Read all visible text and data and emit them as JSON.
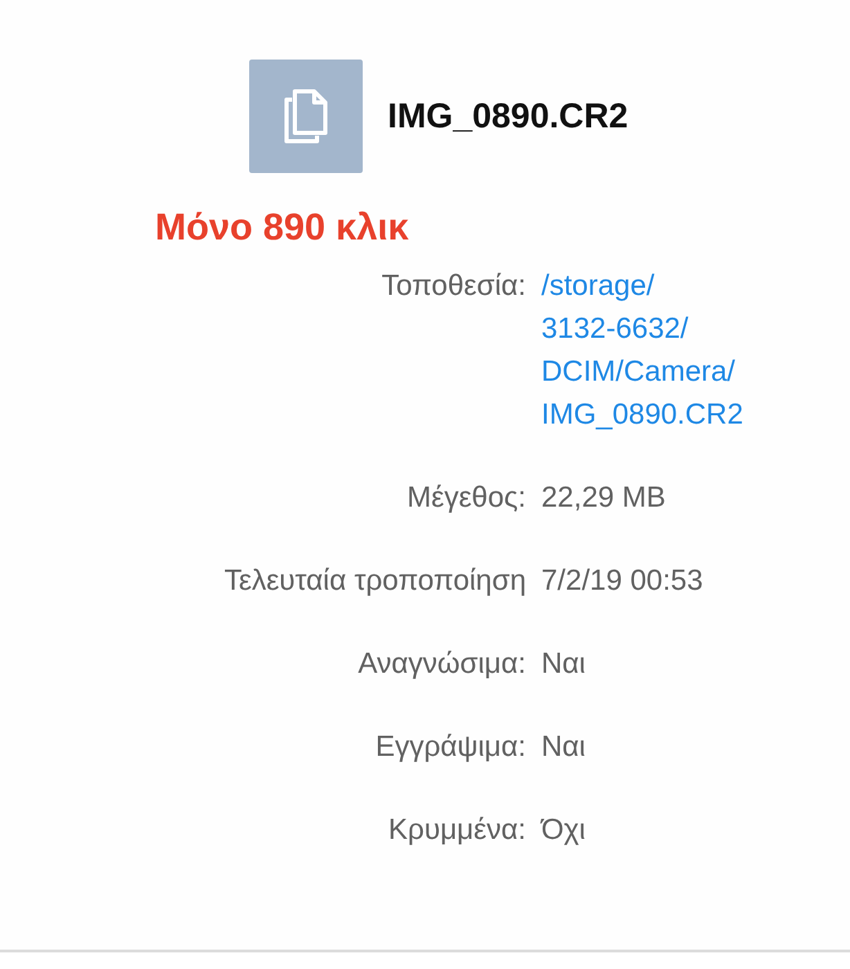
{
  "file": {
    "name": "IMG_0890.CR2"
  },
  "annotation": "Μόνο 890 κλικ",
  "properties": [
    {
      "label": "Τοποθεσία:",
      "kind": "link",
      "value_lines": [
        "/storage/",
        "3132-6632/",
        "DCIM/Camera/",
        "IMG_0890.CR2"
      ]
    },
    {
      "label": "Μέγεθος:",
      "kind": "text",
      "value_lines": [
        "22,29 MB"
      ]
    },
    {
      "label": "Τελευταία τροποποίηση",
      "kind": "text",
      "value_lines": [
        "7/2/19 00:53"
      ]
    },
    {
      "label": "Αναγνώσιμα:",
      "kind": "text",
      "value_lines": [
        "Ναι"
      ]
    },
    {
      "label": "Εγγράψιμα:",
      "kind": "text",
      "value_lines": [
        "Ναι"
      ]
    },
    {
      "label": "Κρυμμένα:",
      "kind": "text",
      "value_lines": [
        "Όχι"
      ]
    }
  ]
}
